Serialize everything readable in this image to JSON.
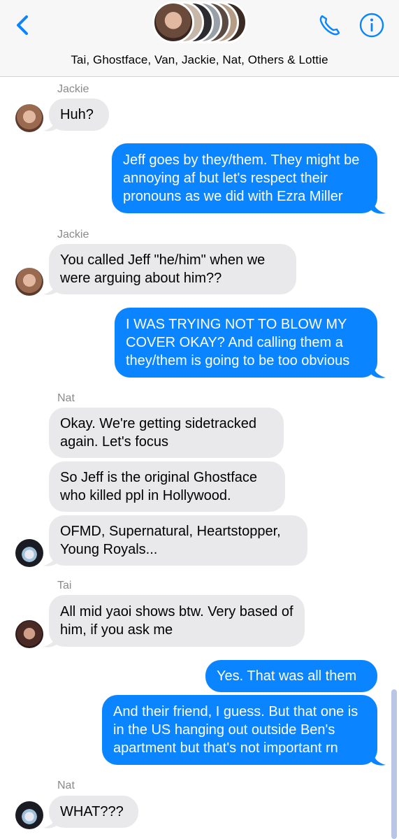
{
  "header": {
    "title": "Tai, Ghostface, Van, Jackie, Nat, Others & Lottie",
    "back_icon": "chevron-left-icon",
    "call_icon": "phone-icon",
    "info_icon": "info-icon",
    "accent": "#0a84ff"
  },
  "messages": [
    {
      "sender": "Jackie",
      "text": "Huh?"
    },
    {
      "text": "Jeff goes by they/them. They might be annoying af but let's respect their pronouns as we did with Ezra Miller"
    },
    {
      "sender": "Jackie",
      "text": "You called Jeff \"he/him\" when we were arguing about him??"
    },
    {
      "text": "I WAS TRYING NOT TO BLOW MY COVER OKAY? And calling them a they/them is going to be too obvious"
    },
    {
      "sender": "Nat",
      "text": "Okay. We're getting sidetracked again. Let's focus"
    },
    {
      "text": "So Jeff is the original Ghostface who killed ppl in Hollywood."
    },
    {
      "text": "OFMD, Supernatural, Heartstopper, Young Royals..."
    },
    {
      "sender": "Tai",
      "text": "All mid yaoi shows btw. Very based of him, if you ask me"
    },
    {
      "text": "Yes. That was all them"
    },
    {
      "text": "And their friend, I guess. But that one is in the US hanging out outside Ben's apartment but that's not important rn"
    },
    {
      "sender": "Nat",
      "text": "WHAT???"
    }
  ],
  "colors": {
    "incoming": "#e9e9eb",
    "outgoing": "#0a84ff",
    "sender_label": "#8a8a8e"
  }
}
